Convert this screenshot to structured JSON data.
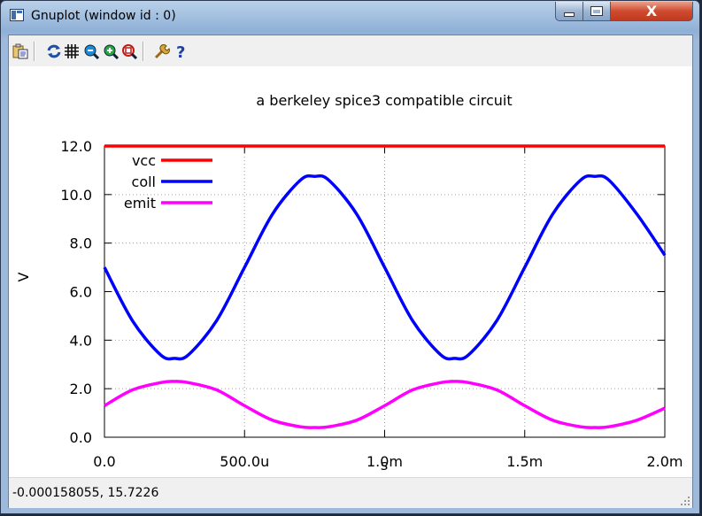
{
  "window": {
    "title": "Gnuplot (window id : 0)",
    "close_glyph": "X"
  },
  "toolbar": {
    "buttons": [
      "copy-to-clipboard-icon",
      "replot-icon",
      "grid-icon",
      "zoom-previous-icon",
      "zoom-next-icon",
      "unzoom-icon",
      "options-icon",
      "help-icon"
    ]
  },
  "colors": {
    "vcc": "#ff0000",
    "coll": "#0000ff",
    "emit": "#ff00ff",
    "grid": "#a0a0a0"
  },
  "chart_data": {
    "type": "line",
    "title": "a berkeley spice3 compatible circuit",
    "xlabel": "s",
    "ylabel": "V",
    "xlim": [
      0,
      0.002
    ],
    "ylim": [
      0,
      12
    ],
    "grid": true,
    "legend_position": "top-left",
    "xticks": [
      {
        "value": 0,
        "label": "0.0"
      },
      {
        "value": 0.0005,
        "label": "500.0u"
      },
      {
        "value": 0.001,
        "label": "1.0m"
      },
      {
        "value": 0.0015,
        "label": "1.5m"
      },
      {
        "value": 0.002,
        "label": "2.0m"
      }
    ],
    "yticks": [
      {
        "value": 0,
        "label": "0.0"
      },
      {
        "value": 2,
        "label": "2.0"
      },
      {
        "value": 4,
        "label": "4.0"
      },
      {
        "value": 6,
        "label": "6.0"
      },
      {
        "value": 8,
        "label": "8.0"
      },
      {
        "value": 10,
        "label": "10.0"
      },
      {
        "value": 12,
        "label": "12.0"
      }
    ],
    "x": [
      0,
      0.0001,
      0.0002,
      0.00025,
      0.0003,
      0.0004,
      0.0005,
      0.0006,
      0.0007,
      0.00075,
      0.0008,
      0.0009,
      0.001,
      0.0011,
      0.0012,
      0.00125,
      0.0013,
      0.0014,
      0.0015,
      0.0016,
      0.0017,
      0.00175,
      0.0018,
      0.0019,
      0.002
    ],
    "series": [
      {
        "name": "vcc",
        "values": [
          12,
          12,
          12,
          12,
          12,
          12,
          12,
          12,
          12,
          12,
          12,
          12,
          12,
          12,
          12,
          12,
          12,
          12,
          12,
          12,
          12,
          12,
          12,
          12,
          12
        ]
      },
      {
        "name": "coll",
        "values": [
          7.0,
          4.8,
          3.4,
          3.25,
          3.4,
          4.8,
          7.0,
          9.2,
          10.6,
          10.75,
          10.6,
          9.2,
          7.0,
          4.8,
          3.4,
          3.25,
          3.4,
          4.8,
          7.0,
          9.2,
          10.6,
          10.75,
          10.6,
          9.2,
          7.5
        ]
      },
      {
        "name": "emit",
        "values": [
          1.3,
          1.95,
          2.25,
          2.3,
          2.25,
          1.95,
          1.3,
          0.7,
          0.43,
          0.4,
          0.43,
          0.7,
          1.3,
          1.95,
          2.25,
          2.3,
          2.25,
          1.95,
          1.3,
          0.7,
          0.43,
          0.4,
          0.43,
          0.7,
          1.2
        ]
      }
    ]
  },
  "status_bar": {
    "coordinates": "-0.000158055,  15.7226"
  }
}
